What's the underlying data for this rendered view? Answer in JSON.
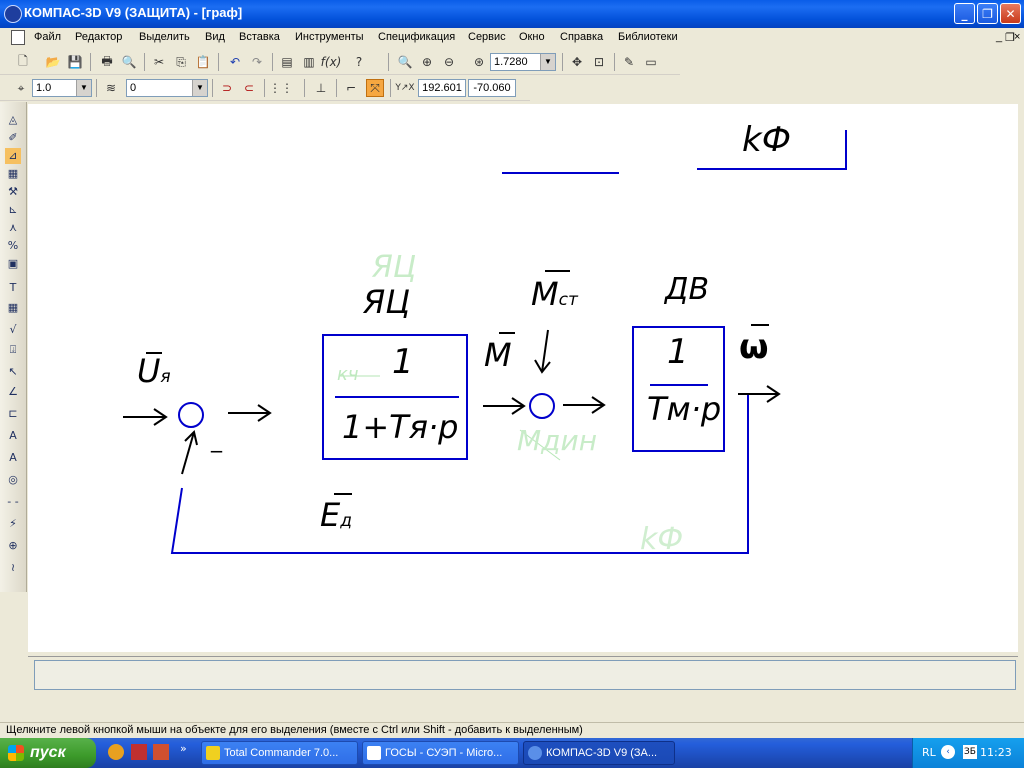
{
  "window": {
    "title": "КОМПАС-3D V9 (ЗАЩИТА) - [граф]",
    "controls": {
      "minimize": "_",
      "maximize": "❐",
      "close": "✕"
    },
    "doc_controls": {
      "minimize": "_",
      "restore": "❐",
      "close": "×"
    }
  },
  "menu": {
    "items": [
      "Файл",
      "Редактор",
      "Выделить",
      "Вид",
      "Вставка",
      "Инструменты",
      "Спецификация",
      "Сервис",
      "Окно",
      "Справка",
      "Библиотеки"
    ]
  },
  "toolbar_standard": {
    "zoom_value": "1.7280"
  },
  "toolbar_current_state": {
    "scale_value": "1.0",
    "layer_value": "0",
    "coord_x": "192.601",
    "coord_y": "-70.060"
  },
  "diagram": {
    "top_label": "kФ",
    "label_yac": "ЯЦ",
    "label_yac_ghost": "ЯЦ",
    "label_dv": "ДВ",
    "label_u": "U",
    "label_u_sub": "я",
    "label_minus": "_",
    "label_m": "M",
    "label_mst": "M",
    "label_mst_sub": "ст",
    "label_omega": "ω",
    "label_ed": "E",
    "label_ed_sub": "д",
    "block1_num": "1",
    "block1_num_ghost": "кч",
    "block1_den": "1+Тя·р",
    "block2_num": "1",
    "block2_den": "Тм·р",
    "ghost_mdin": "Mдин",
    "ghost_kf": "kФ"
  },
  "status": {
    "hint": "Щелкните левой кнопкой мыши на объекте для его выделения (вместе с Ctrl или Shift - добавить к выделенным)"
  },
  "taskbar": {
    "start_label": "пуск",
    "tasks": [
      {
        "label": "Total Commander 7.0..."
      },
      {
        "label": "ГОСЫ - СУЭП - Micro..."
      },
      {
        "label": "КОМПАС-3D V9 (ЗА..."
      }
    ],
    "tray_lang": "RL",
    "lang_indicator": "ЗБ",
    "clock": "11:23"
  },
  "colors": {
    "titlebar": "#0a5de8",
    "diagram_lines": "#0000cc",
    "ghost_text": "#90d090",
    "taskbar": "#245edb"
  }
}
